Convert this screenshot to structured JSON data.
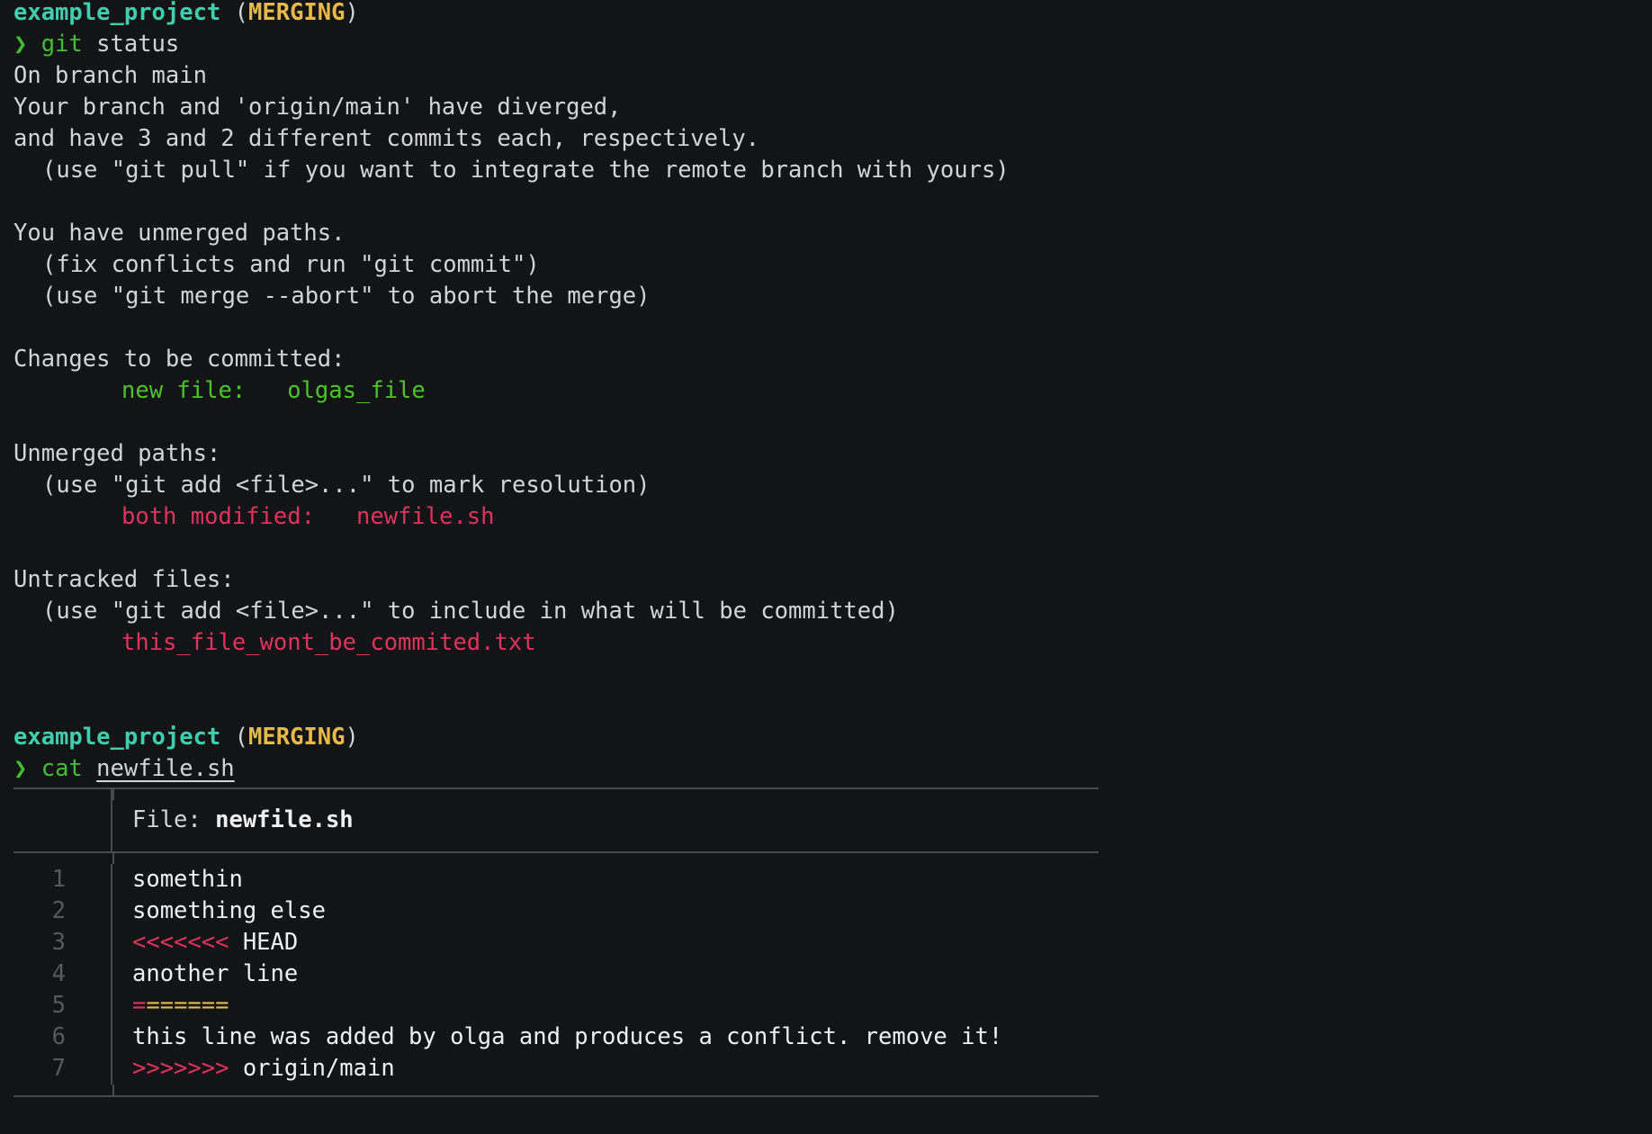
{
  "prompt1": {
    "project": "example_project",
    "open_paren": "(",
    "state": "MERGING",
    "close_paren": ")",
    "chevron": "❯",
    "command": "git",
    "args": " status"
  },
  "status_lines": {
    "l1": "On branch main",
    "l2": "Your branch and 'origin/main' have diverged,",
    "l3": "and have 3 and 2 different commits each, respectively.",
    "l4": "(use \"git pull\" if you want to integrate the remote branch with yours)",
    "l5": "You have unmerged paths.",
    "l6": "(fix conflicts and run \"git commit\")",
    "l7": "(use \"git merge --abort\" to abort the merge)",
    "l8": "Changes to be committed:",
    "l9": "new file:   olgas_file",
    "l10": "Unmerged paths:",
    "l11": "(use \"git add <file>...\" to mark resolution)",
    "l12": "both modified:   newfile.sh",
    "l13": "Untracked files:",
    "l14": "(use \"git add <file>...\" to include in what will be committed)",
    "l15": "this_file_wont_be_commited.txt"
  },
  "prompt2": {
    "project": "example_project",
    "open_paren": "(",
    "state": "MERGING",
    "close_paren": ")",
    "chevron": "❯",
    "command": "cat",
    "arg": "newfile.sh"
  },
  "file_view": {
    "label": "File: ",
    "filename": "newfile.sh",
    "lines": [
      {
        "num": "1",
        "text": "somethin"
      },
      {
        "num": "2",
        "text": "something else"
      },
      {
        "num": "3",
        "marker": "<<<<<<<",
        "text": " HEAD"
      },
      {
        "num": "4",
        "text": "another line"
      },
      {
        "num": "5",
        "eq_a": "=",
        "eq_b": "======"
      },
      {
        "num": "6",
        "text": "this line was added by olga and produces a conflict. remove it!"
      },
      {
        "num": "7",
        "marker": ">>>>>>>",
        "text": " origin/main"
      }
    ]
  },
  "colors": {
    "background": "#131416",
    "project": "#3fcfae",
    "merging": "#e6b94a",
    "prompt_green": "#40c030",
    "staged_green": "#4cc429",
    "conflict_red": "#e0325e"
  }
}
